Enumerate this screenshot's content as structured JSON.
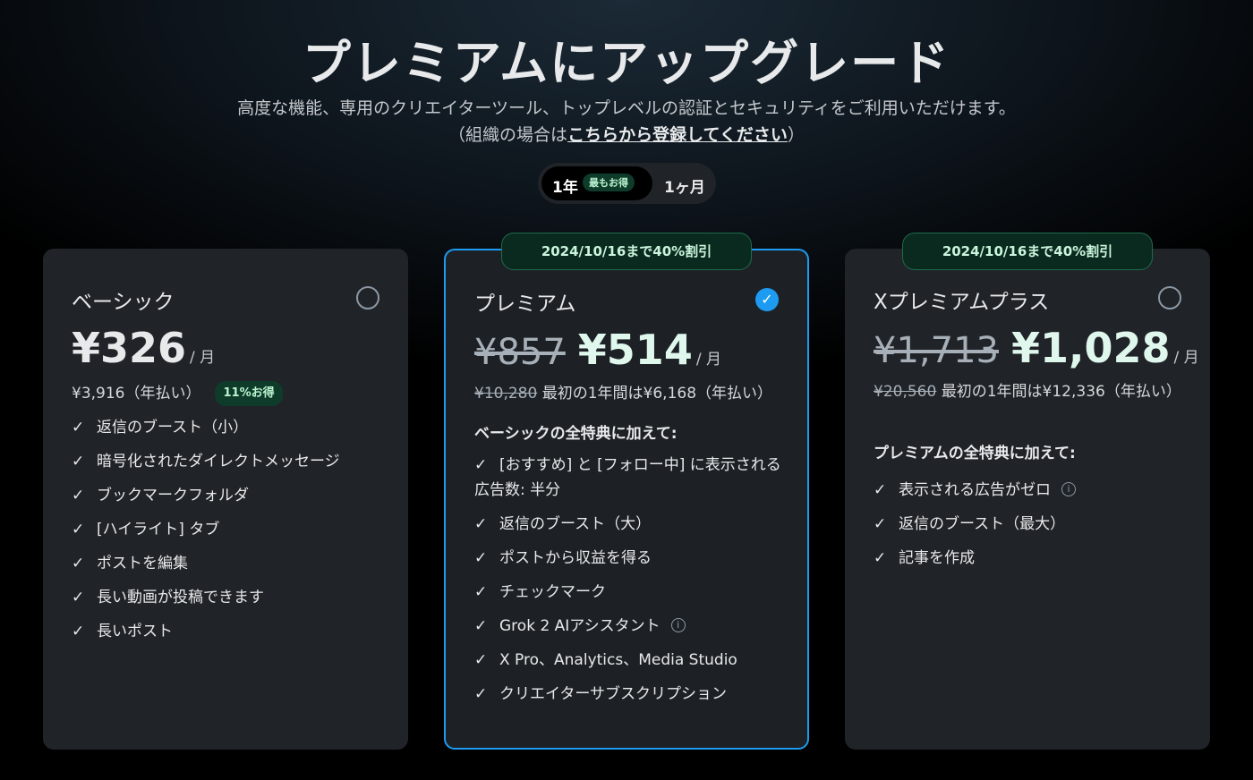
{
  "header": {
    "title": "プレミアムにアップグレード",
    "subtitle_line1": "高度な機能、専用のクリエイターツール、トップレベルの認証とセキュリティをご利用いただけます。",
    "subtitle_prefix": "（組織の場合は",
    "subtitle_link": "こちらから登録してください",
    "subtitle_suffix": "）"
  },
  "billing_toggle": {
    "yearly_label": "1年",
    "yearly_badge": "最もお得",
    "monthly_label": "1ヶ月",
    "selected": "yearly"
  },
  "plans": [
    {
      "name": "ベーシック",
      "selected": false,
      "price": "¥326",
      "per": "/ 月",
      "annual_text": "¥3,916（年払い）",
      "save_badge": "11%お得",
      "features": [
        "返信のブースト（小）",
        "暗号化されたダイレクトメッセージ",
        "ブックマークフォルダ",
        "[ハイライト] タブ",
        "ポストを編集",
        "長い動画が投稿できます",
        "長いポスト"
      ]
    },
    {
      "name": "プレミアム",
      "selected": true,
      "promo": "2024/10/16まで40%割引",
      "old_price": "¥857",
      "price": "¥514",
      "per": "/ 月",
      "annual_old": "¥10,280",
      "annual_text": " 最初の1年間は¥6,168（年払い）",
      "heading": "ベーシックの全特典に加えて:",
      "features": [
        "[おすすめ] と [フォロー中] に表示される広告数: 半分",
        "返信のブースト（大）",
        "ポストから収益を得る",
        "チェックマーク",
        "Grok 2 AIアシスタント",
        "X Pro、Analytics、Media Studio",
        "クリエイターサブスクリプション"
      ]
    },
    {
      "name": "Xプレミアムプラス",
      "selected": false,
      "promo": "2024/10/16まで40%割引",
      "old_price": "¥1,713",
      "price": "¥1,028",
      "per": "/ 月",
      "annual_old": "¥20,560",
      "annual_text": " 最初の1年間は¥12,336（年払い）",
      "heading": "プレミアムの全特典に加えて:",
      "features": [
        "表示される広告がゼロ",
        "返信のブースト（最大）",
        "記事を作成"
      ]
    }
  ],
  "icons": {
    "check": "checkmark-icon",
    "info": "info-icon",
    "radio": "radio-icon"
  },
  "colors": {
    "accent": "#1d9bf0",
    "badge_bg": "#0f3b2b",
    "badge_text": "#b9f3cf",
    "card_bg": "#202327"
  }
}
